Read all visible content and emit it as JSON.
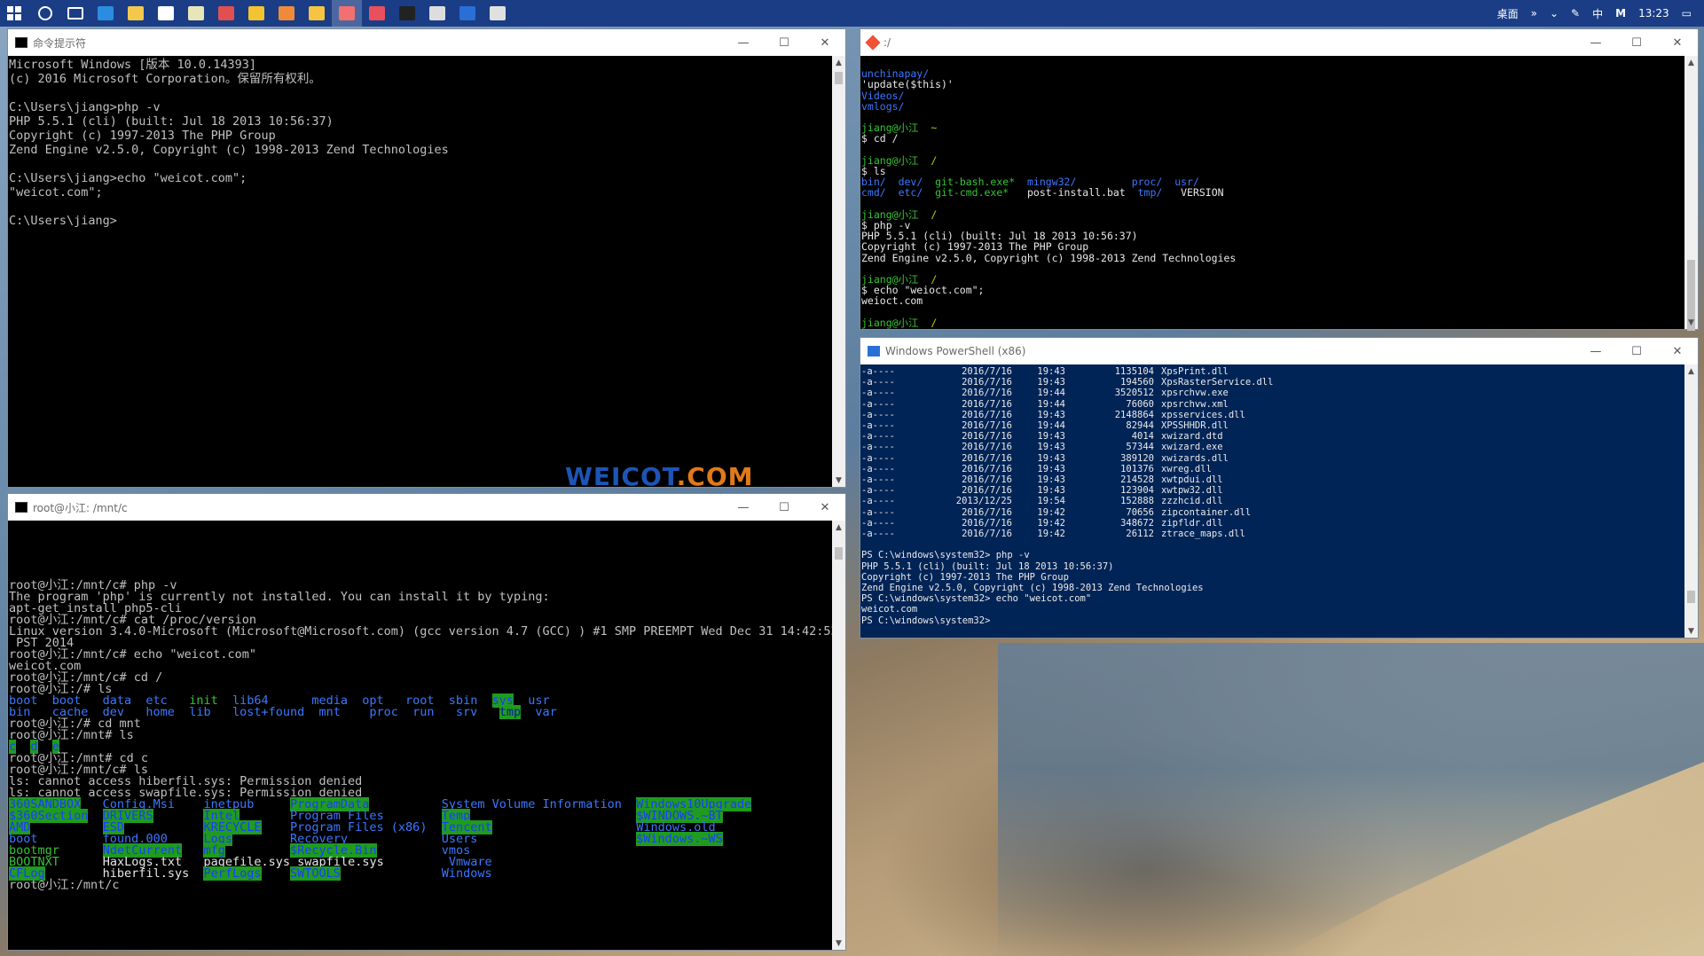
{
  "taskbar": {
    "icons": [
      {
        "name": "windows-start-icon",
        "color": "#ffffff"
      },
      {
        "name": "cortana-circle-icon",
        "color": "#ffffff"
      },
      {
        "name": "task-view-icon",
        "color": "#ffffff"
      },
      {
        "name": "edge-icon",
        "color": "#2b8de0"
      },
      {
        "name": "file-explorer-icon",
        "color": "#f2c94c"
      },
      {
        "name": "store-icon",
        "color": "#ffffff"
      },
      {
        "name": "notepad-icon",
        "color": "#e6e6b8"
      },
      {
        "name": "app-red-icon",
        "color": "#e05050"
      },
      {
        "name": "app-yellow-icon",
        "color": "#f4c330"
      },
      {
        "name": "app-orange-icon",
        "color": "#f08a3b"
      },
      {
        "name": "chrome-icon",
        "color": "#f5c542"
      },
      {
        "name": "app-active-icon",
        "color": "#f27070",
        "active": true
      },
      {
        "name": "app-rn-icon",
        "color": "#e8505b"
      },
      {
        "name": "cmd-icon",
        "color": "#222222"
      },
      {
        "name": "app-board-icon",
        "color": "#dddddd"
      },
      {
        "name": "powershell-icon",
        "color": "#2a6fd6"
      },
      {
        "name": "git-icon",
        "color": "#e0e0e0"
      }
    ],
    "tray": {
      "desktop_label": "桌面",
      "chevrons": "»",
      "ime": "中",
      "ime2": "M",
      "clock": "13:23"
    }
  },
  "cmd": {
    "title": "命令提示符",
    "lines": [
      "Microsoft Windows [版本 10.0.14393]",
      "(c) 2016 Microsoft Corporation。保留所有权利。",
      "",
      "C:\\Users\\jiang>php -v",
      "PHP 5.5.1 (cli) (built: Jul 18 2013 10:56:37)",
      "Copyright (c) 1997-2013 The PHP Group",
      "Zend Engine v2.5.0, Copyright (c) 1998-2013 Zend Technologies",
      "",
      "C:\\Users\\jiang>echo \"weicot.com\";",
      "\"weicot.com\";",
      "",
      "C:\\Users\\jiang>"
    ],
    "logo_part1": "WEICOT",
    "logo_part2": ".COM"
  },
  "wsl": {
    "title": "root@小江: /mnt/c"
  },
  "bash": {
    "title": ":/"
  },
  "ps": {
    "title": "Windows PowerShell (x86)",
    "rows": [
      [
        "-a----",
        "2016/7/16",
        "19:43",
        "1135104",
        "XpsPrint.dll"
      ],
      [
        "-a----",
        "2016/7/16",
        "19:43",
        "194560",
        "XpsRasterService.dll"
      ],
      [
        "-a----",
        "2016/7/16",
        "19:44",
        "3520512",
        "xpsrchvw.exe"
      ],
      [
        "-a----",
        "2016/7/16",
        "19:44",
        "76060",
        "xpsrchvw.xml"
      ],
      [
        "-a----",
        "2016/7/16",
        "19:43",
        "2148864",
        "xpsservices.dll"
      ],
      [
        "-a----",
        "2016/7/16",
        "19:44",
        "82944",
        "XPSSHHDR.dll"
      ],
      [
        "-a----",
        "2016/7/16",
        "19:43",
        "4014",
        "xwizard.dtd"
      ],
      [
        "-a----",
        "2016/7/16",
        "19:43",
        "57344",
        "xwizard.exe"
      ],
      [
        "-a----",
        "2016/7/16",
        "19:43",
        "389120",
        "xwizards.dll"
      ],
      [
        "-a----",
        "2016/7/16",
        "19:43",
        "101376",
        "xwreg.dll"
      ],
      [
        "-a----",
        "2016/7/16",
        "19:43",
        "214528",
        "xwtpdui.dll"
      ],
      [
        "-a----",
        "2016/7/16",
        "19:43",
        "123904",
        "xwtpw32.dll"
      ],
      [
        "-a----",
        "2013/12/25",
        "19:54",
        "152888",
        "zzzhcid.dll"
      ],
      [
        "-a----",
        "2016/7/16",
        "19:42",
        "70656",
        "zipcontainer.dll"
      ],
      [
        "-a----",
        "2016/7/16",
        "19:42",
        "348672",
        "zipfldr.dll"
      ],
      [
        "-a----",
        "2016/7/16",
        "19:42",
        "26112",
        "ztrace_maps.dll"
      ]
    ],
    "tail": [
      "",
      "PS C:\\windows\\system32> php -v",
      "PHP 5.5.1 (cli) (built: Jul 18 2013 10:56:37)",
      "Copyright (c) 1997-2013 The PHP Group",
      "Zend Engine v2.5.0, Copyright (c) 1998-2013 Zend Technologies",
      "PS C:\\windows\\system32> echo \"weicot.com\"",
      "weicot.com",
      "PS C:\\windows\\system32>"
    ]
  },
  "window_controls": {
    "minimize": "—",
    "maximize": "☐",
    "close": "✕"
  }
}
